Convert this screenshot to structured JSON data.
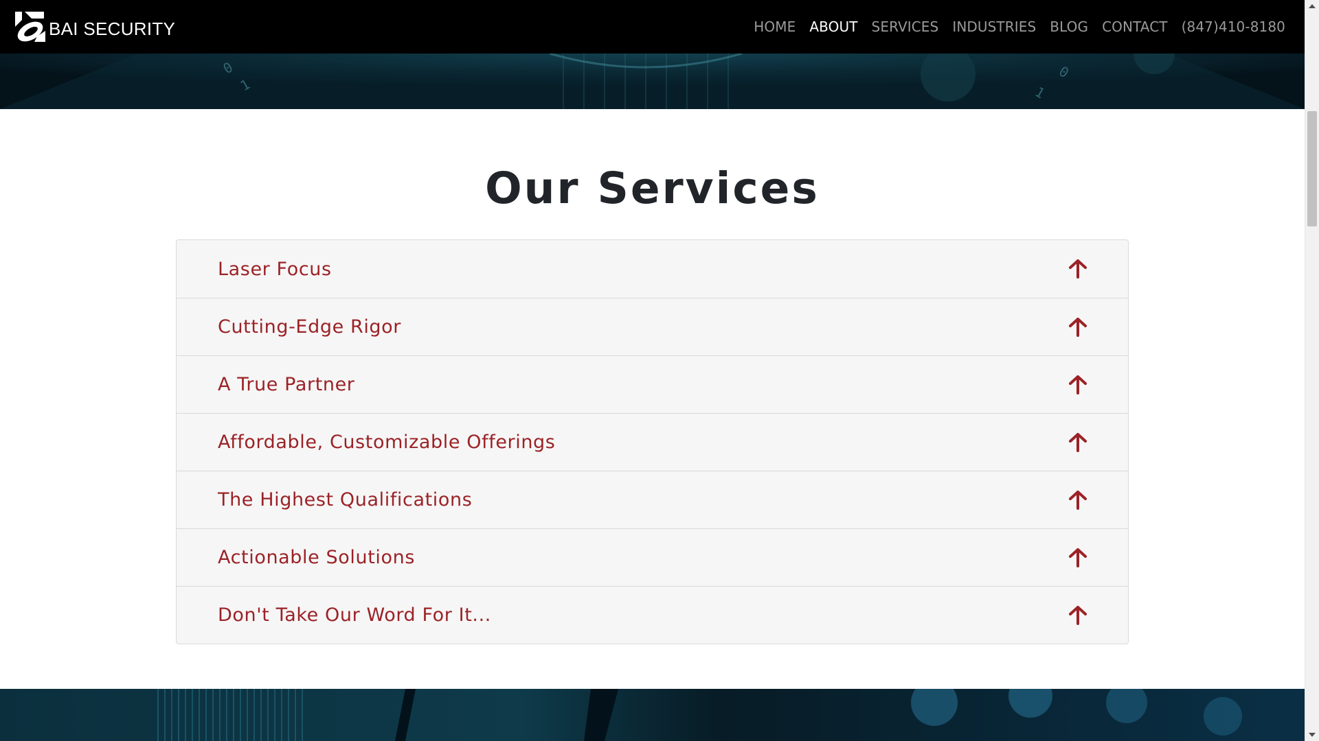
{
  "brand": {
    "name": "BAI SECURITY",
    "logo_icon": "bai-logo-icon"
  },
  "nav": {
    "items": [
      {
        "label": "HOME",
        "active": false
      },
      {
        "label": "ABOUT",
        "active": true
      },
      {
        "label": "SERVICES",
        "active": false
      },
      {
        "label": "INDUSTRIES",
        "active": false
      },
      {
        "label": "BLOG",
        "active": false
      },
      {
        "label": "CONTACT",
        "active": false
      },
      {
        "label": "(847)410-8180",
        "active": false
      }
    ]
  },
  "services": {
    "title": "Our Services",
    "items": [
      {
        "label": "Laser Focus",
        "icon": "arrow-up-icon"
      },
      {
        "label": "Cutting-Edge Rigor",
        "icon": "arrow-up-icon"
      },
      {
        "label": "A True Partner",
        "icon": "arrow-up-icon"
      },
      {
        "label": "Affordable, Customizable Offerings",
        "icon": "arrow-up-icon"
      },
      {
        "label": "The Highest Qualifications",
        "icon": "arrow-up-icon"
      },
      {
        "label": "Actionable Solutions",
        "icon": "arrow-up-icon"
      },
      {
        "label": "Don't Take Our Word For It...",
        "icon": "arrow-up-icon"
      }
    ]
  },
  "colors": {
    "header_bg": "#000000",
    "accent_red": "#9b2226",
    "title_text": "#212529",
    "accordion_bg": "#f6f6f6",
    "hero_bg": "#05141c"
  }
}
